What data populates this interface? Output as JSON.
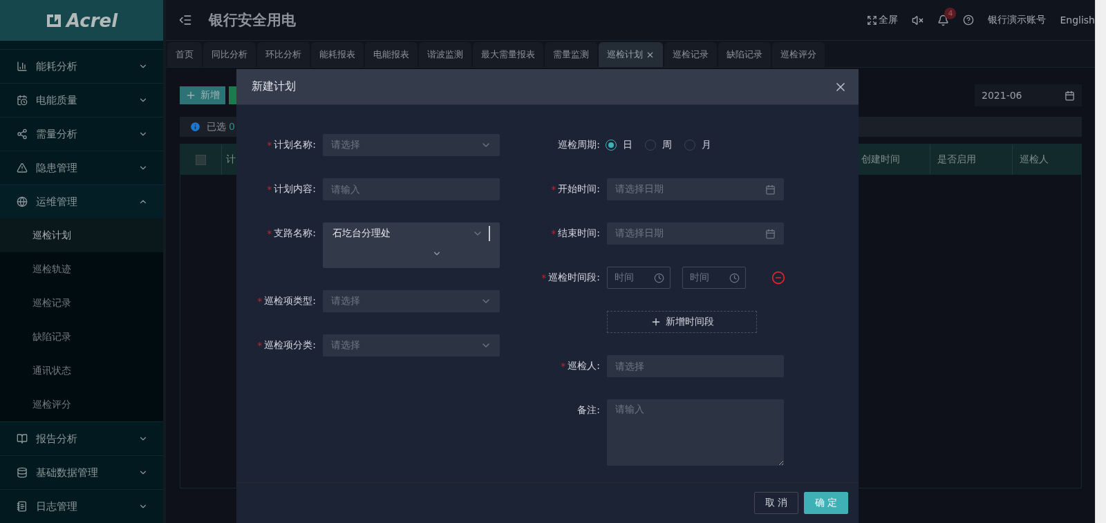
{
  "sidebar": {
    "logo": "Acrel",
    "items": [
      {
        "label": "能耗分析",
        "expanded": false
      },
      {
        "label": "电能质量",
        "expanded": false
      },
      {
        "label": "需量分析",
        "expanded": false
      },
      {
        "label": "隐患管理",
        "expanded": false
      },
      {
        "label": "运维管理",
        "expanded": true,
        "children": [
          {
            "label": "巡检计划",
            "selected": true
          },
          {
            "label": "巡检轨迹",
            "selected": false
          },
          {
            "label": "巡检记录",
            "selected": false
          },
          {
            "label": "缺陷记录",
            "selected": false
          },
          {
            "label": "通讯状态",
            "selected": false
          },
          {
            "label": "巡检评分",
            "selected": false
          }
        ]
      },
      {
        "label": "报告分析",
        "expanded": false
      },
      {
        "label": "基础数据管理",
        "expanded": false
      },
      {
        "label": "日志管理",
        "expanded": false
      }
    ]
  },
  "header": {
    "title": "银行安全用电",
    "fullscreen": "全屏",
    "notification_count": "4",
    "account": "银行演示账号",
    "language": "English"
  },
  "tabs": [
    {
      "label": "首页",
      "selected": false
    },
    {
      "label": "同比分析",
      "selected": false
    },
    {
      "label": "环比分析",
      "selected": false
    },
    {
      "label": "能耗报表",
      "selected": false
    },
    {
      "label": "电能报表",
      "selected": false
    },
    {
      "label": "谐波监测",
      "selected": false
    },
    {
      "label": "最大需量报表",
      "selected": false
    },
    {
      "label": "需量监测",
      "selected": false
    },
    {
      "label": "巡检计划",
      "selected": true
    },
    {
      "label": "巡检记录",
      "selected": false
    },
    {
      "label": "缺陷记录",
      "selected": false
    },
    {
      "label": "巡检评分",
      "selected": false
    }
  ],
  "toolbar": {
    "add_button": "新增",
    "date": "2021-06"
  },
  "selection_info": {
    "label": "已选",
    "count": "0"
  },
  "table": {
    "select_all_checked": false,
    "columns": [
      "计",
      "创建时间",
      "是否启用",
      "巡检人"
    ]
  },
  "dialog": {
    "title": "新建计划",
    "left_fields": [
      {
        "kind": "select",
        "required_mark": "*",
        "label": "计划名称:",
        "placeholder": "请选择"
      },
      {
        "kind": "input",
        "required_mark": "*",
        "label": "计划内容:",
        "placeholder": "请输入"
      },
      {
        "kind": "multiselect",
        "required_mark": "*",
        "label": "支路名称:",
        "value": "石圪台分理处"
      },
      {
        "kind": "select",
        "required_mark": "*",
        "label": "巡检项类型:",
        "placeholder": "请选择"
      },
      {
        "kind": "select",
        "required_mark": "*",
        "label": "巡检项分类:",
        "placeholder": "请选择"
      }
    ],
    "right_fields": [
      {
        "kind": "radio",
        "label": "巡检周期:",
        "options": [
          {
            "label": "日",
            "selected": true
          },
          {
            "label": "周",
            "selected": false
          },
          {
            "label": "月",
            "selected": false
          }
        ]
      },
      {
        "kind": "date",
        "required_mark": "*",
        "label": "开始时间:",
        "placeholder": "请选择日期"
      },
      {
        "kind": "date",
        "required_mark": "*",
        "label": "结束时间:",
        "placeholder": "请选择日期"
      },
      {
        "kind": "timerange",
        "required_mark": "*",
        "label": "巡检时间段:",
        "start_placeholder": "时间",
        "end_placeholder": "时间"
      },
      {
        "kind": "addbutton",
        "label": "新增时间段"
      },
      {
        "kind": "input",
        "required_mark": "*",
        "label": "巡检人:",
        "placeholder": "请选择"
      },
      {
        "kind": "textarea",
        "label": "备注:",
        "placeholder": "请输入"
      }
    ],
    "cancel": "取 消",
    "confirm": "确 定"
  }
}
